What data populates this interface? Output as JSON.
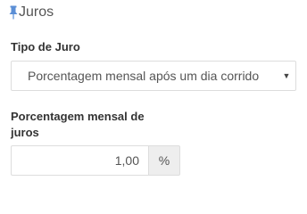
{
  "section": {
    "title": "Juros",
    "icon": "pushpin-icon",
    "icon_color": "#5b8fd6"
  },
  "tipo_juro": {
    "label": "Tipo de Juro",
    "selected": "Porcentagem mensal após um dia corrido",
    "caret": "▼"
  },
  "porcentagem": {
    "label": "Porcentagem mensal de juros",
    "value": "1,00",
    "addon": "%"
  }
}
